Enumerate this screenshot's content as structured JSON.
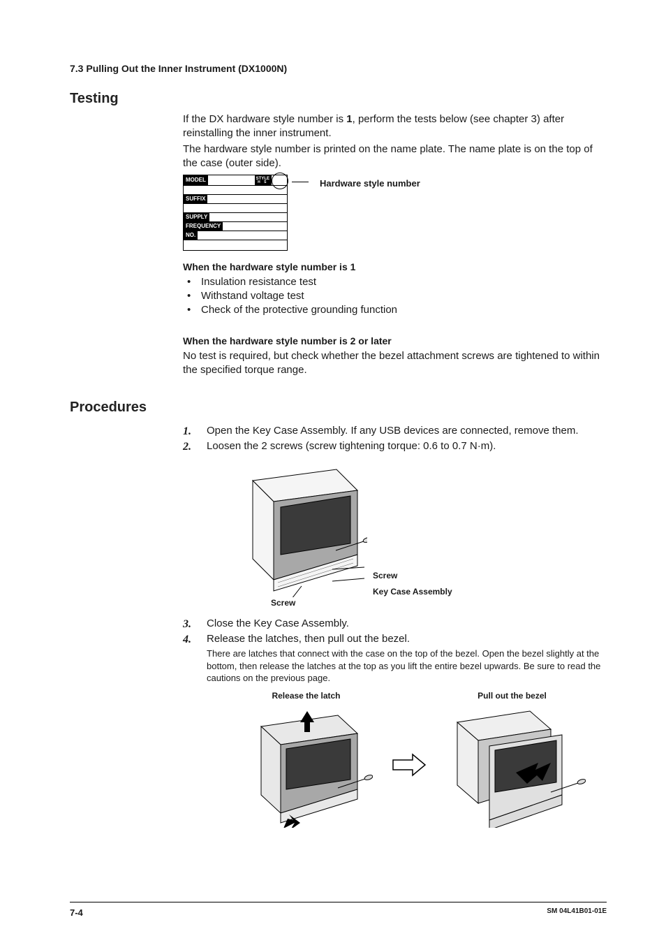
{
  "header": {
    "section": "7.3  Pulling Out the Inner Instrument (DX1000N)"
  },
  "testing": {
    "title": "Testing",
    "intro1a": "If the DX hardware style number is ",
    "intro1bold": "1",
    "intro1b": ", perform the tests below (see chapter 3) after reinstalling the inner instrument.",
    "intro2": "The hardware style number is printed on the name plate. The name plate is on the top of the case (outer side).",
    "nameplate": {
      "rows": [
        "MODEL",
        "SUFFIX",
        "SUPPLY",
        "FREQUENCY",
        "NO."
      ],
      "style_top": "STYLE",
      "style_sub": "H        S",
      "caption": "Hardware style number"
    },
    "sub1": {
      "heading": "When the hardware style number is 1",
      "bullets": [
        "Insulation resistance test",
        "Withstand voltage test",
        "Check of the protective grounding function"
      ]
    },
    "sub2": {
      "heading": "When the hardware style number is 2 or later",
      "text": "No test is required, but check whether the bezel attachment screws are tightened to within the specified torque range."
    }
  },
  "procedures": {
    "title": "Procedures",
    "steps": [
      {
        "text": "Open the Key Case Assembly. If any USB devices are connected, remove them."
      },
      {
        "text": "Loosen the 2 screws (screw tightening torque: 0.6 to 0.7 N·m).",
        "labels": {
          "screw_left": "Screw",
          "screw_right": "Screw",
          "kca": "Key Case Assembly"
        }
      },
      {
        "text": "Close the Key Case Assembly."
      },
      {
        "text": "Release the latches, then pull out the bezel.",
        "note": "There are latches that connect with the case on the top of the bezel. Open the bezel slightly at the bottom, then release the latches at the top as you lift the entire bezel upwards. Be sure to read the cautions on the previous page.",
        "captions": {
          "left": "Release the latch",
          "right": "Pull out the bezel"
        }
      }
    ]
  },
  "footer": {
    "page": "7-4",
    "doc": "SM 04L41B01-01E"
  }
}
